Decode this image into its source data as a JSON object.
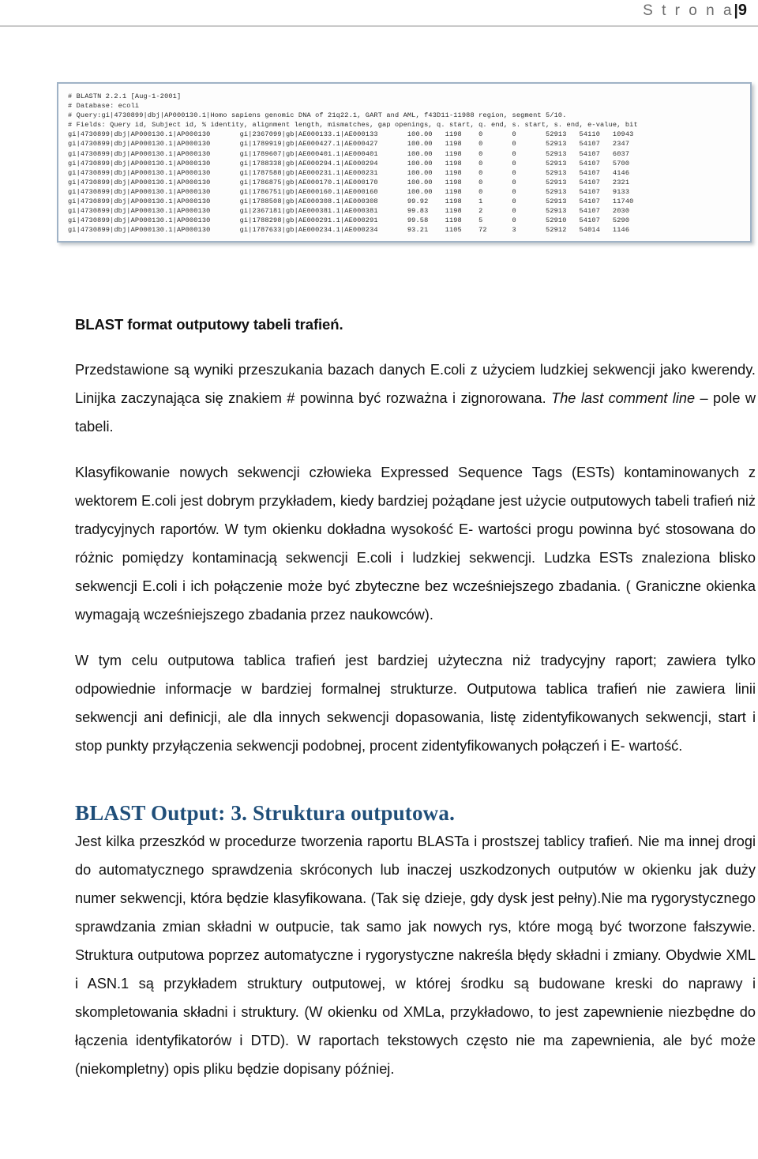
{
  "header": {
    "label": "S t r o n a",
    "separator": "|",
    "page_number": "9"
  },
  "figure": {
    "name": "blast-tabular-output",
    "border_color": "#9fb2c6",
    "lines": [
      "# BLASTN 2.2.1 [Aug-1-2001]",
      "# Database: ecoli",
      "# Query:gi|4730899|dbj|AP000130.1|Homo sapiens genomic DNA of 21q22.1, GART and AML, f43D11-11988 region, segment 5/10.",
      "# Fields: Query id, Subject id, % identity, alignment length, mismatches, gap openings, q. start, q. end, s. start, s. end, e-value, bit"
    ],
    "columns": [
      "query_id",
      "subject_id",
      "identity",
      "alignment_length",
      "mismatches",
      "gap_openings",
      "q_start",
      "q_end",
      "s_start",
      "s_end"
    ],
    "rows": [
      [
        "gi|4730899|dbj|AP000130.1|AP000130",
        "gi|2367099|gb|AE000133.1|AE000133",
        "100.00",
        "1198",
        "0",
        "0",
        "52913",
        "54110",
        "10943"
      ],
      [
        "gi|4730899|dbj|AP000130.1|AP000130",
        "gi|1789919|gb|AE000427.1|AE000427",
        "100.00",
        "1198",
        "0",
        "0",
        "52913",
        "54107",
        "2347"
      ],
      [
        "gi|4730899|dbj|AP000130.1|AP000130",
        "gi|1789607|gb|AE000401.1|AE000401",
        "100.00",
        "1198",
        "0",
        "0",
        "52913",
        "54107",
        "6037"
      ],
      [
        "gi|4730899|dbj|AP000130.1|AP000130",
        "gi|1788338|gb|AE000294.1|AE000294",
        "100.00",
        "1198",
        "0",
        "0",
        "52913",
        "54107",
        "5700"
      ],
      [
        "gi|4730899|dbj|AP000130.1|AP000130",
        "gi|1787588|gb|AE000231.1|AE000231",
        "100.00",
        "1198",
        "0",
        "0",
        "52913",
        "54107",
        "4146"
      ],
      [
        "gi|4730899|dbj|AP000130.1|AP000130",
        "gi|1786875|gb|AE000170.1|AE000170",
        "100.00",
        "1198",
        "0",
        "0",
        "52913",
        "54107",
        "2321"
      ],
      [
        "gi|4730899|dbj|AP000130.1|AP000130",
        "gi|1786751|gb|AE000160.1|AE000160",
        "100.00",
        "1198",
        "0",
        "0",
        "52913",
        "54107",
        "9133"
      ],
      [
        "gi|4730899|dbj|AP000130.1|AP000130",
        "gi|1788508|gb|AE000308.1|AE000308",
        "99.92",
        "1198",
        "1",
        "0",
        "52913",
        "54107",
        "11740"
      ],
      [
        "gi|4730899|dbj|AP000130.1|AP000130",
        "gi|2367181|gb|AE000381.1|AE000381",
        "99.83",
        "1198",
        "2",
        "0",
        "52913",
        "54107",
        "2030"
      ],
      [
        "gi|4730899|dbj|AP000130.1|AP000130",
        "gi|1788298|gb|AE000291.1|AE000291",
        "99.58",
        "1198",
        "5",
        "0",
        "52910",
        "54107",
        "5290"
      ],
      [
        "gi|4730899|dbj|AP000130.1|AP000130",
        "gi|1787633|gb|AE000234.1|AE000234",
        "93.21",
        "1105",
        "72",
        "3",
        "52912",
        "54014",
        "1146"
      ]
    ],
    "raw_text": "# BLASTN 2.2.1 [Aug-1-2001]\n# Database: ecoli\n# Query:gi|4730899|dbj|AP000130.1|Homo sapiens genomic DNA of 21q22.1, GART and AML, f43D11-11988 region, segment 5/10.\n# Fields: Query id, Subject id, % identity, alignment length, mismatches, gap openings, q. start, q. end, s. start, s. end, e-value, bit\ngi|4730899|dbj|AP000130.1|AP000130       gi|2367099|gb|AE000133.1|AE000133       100.00   1198    0       0       52913   54110   10943\ngi|4730899|dbj|AP000130.1|AP000130       gi|1789919|gb|AE000427.1|AE000427       100.00   1198    0       0       52913   54107   2347\ngi|4730899|dbj|AP000130.1|AP000130       gi|1789607|gb|AE000401.1|AE000401       100.00   1198    0       0       52913   54107   6037\ngi|4730899|dbj|AP000130.1|AP000130       gi|1788338|gb|AE000294.1|AE000294       100.00   1198    0       0       52913   54107   5700\ngi|4730899|dbj|AP000130.1|AP000130       gi|1787588|gb|AE000231.1|AE000231       100.00   1198    0       0       52913   54107   4146\ngi|4730899|dbj|AP000130.1|AP000130       gi|1786875|gb|AE000170.1|AE000170       100.00   1198    0       0       52913   54107   2321\ngi|4730899|dbj|AP000130.1|AP000130       gi|1786751|gb|AE000160.1|AE000160       100.00   1198    0       0       52913   54107   9133\ngi|4730899|dbj|AP000130.1|AP000130       gi|1788508|gb|AE000308.1|AE000308       99.92    1198    1       0       52913   54107   11740\ngi|4730899|dbj|AP000130.1|AP000130       gi|2367181|gb|AE000381.1|AE000381       99.83    1198    2       0       52913   54107   2030\ngi|4730899|dbj|AP000130.1|AP000130       gi|1788298|gb|AE000291.1|AE000291       99.58    1198    5       0       52910   54107   5290\ngi|4730899|dbj|AP000130.1|AP000130       gi|1787633|gb|AE000234.1|AE000234       93.21    1105    72      3       52912   54014   1146"
  },
  "body": {
    "subheading": "BLAST format outputowy tabeli trafień.",
    "para1_a": "Przedstawione są wyniki przeszukania bazach danych E.coli z użyciem ludzkiej sekwencji jako kwerendy. Linijka zaczynająca się znakiem # powinna być rozważna i zignorowana. ",
    "para1_italic": "The last comment line",
    "para1_b": " – pole w tabeli.",
    "para2": "Klasyfikowanie nowych sekwencji człowieka Expressed Sequence Tags (ESTs) kontaminowanych z wektorem E.coli jest dobrym przykładem, kiedy bardziej pożądane jest użycie outputowych tabeli trafień niż tradycyjnych raportów. W tym okienku dokładna wysokość E- wartości progu powinna być stosowana do różnic pomiędzy kontaminacją sekwencji E.coli i ludzkiej sekwencji. Ludzka ESTs znaleziona blisko sekwencji E.coli i ich połączenie może być zbyteczne bez wcześniejszego zbadania. ( Graniczne okienka wymagają wcześniejszego zbadania przez naukowców).",
    "para3": "W tym celu outputowa tablica trafień jest bardziej użyteczna niż tradycyjny raport; zawiera tylko odpowiednie informacje w bardziej formalnej strukturze. Outputowa tablica trafień nie zawiera linii sekwencji ani definicji, ale dla innych sekwencji dopasowania, listę zidentyfikowanych sekwencji, start i stop punkty przyłączenia sekwencji podobnej, procent zidentyfikowanych połączeń i E- wartość."
  },
  "section": {
    "heading": "BLAST Output: 3. Struktura outputowa.",
    "heading_color": "#1f4e79",
    "para": "Jest kilka przeszkód w procedurze tworzenia raportu BLASTa i prostszej tablicy trafień. Nie ma innej drogi do automatycznego sprawdzenia skróconych lub inaczej uszkodzonych outputów w okienku jak duży numer sekwencji, która będzie klasyfikowana. (Tak się dzieje, gdy dysk jest pełny).Nie ma rygorystycznego sprawdzania zmian składni w outpucie, tak samo jak nowych rys, które mogą być tworzone fałszywie. Struktura outputowa poprzez automatyczne i rygorystyczne nakreśla błędy składni i zmiany. Obydwie XML i ASN.1 są przykładem struktury outputowej, w której środku są budowane kreski do naprawy i skompletowania składni i struktury. (W okienku od XMLa, przykładowo, to jest zapewnienie niezbędne do łączenia identyfikatorów i DTD). W raportach tekstowych często nie ma zapewnienia, ale być może (niekompletny) opis pliku będzie dopisany później."
  }
}
